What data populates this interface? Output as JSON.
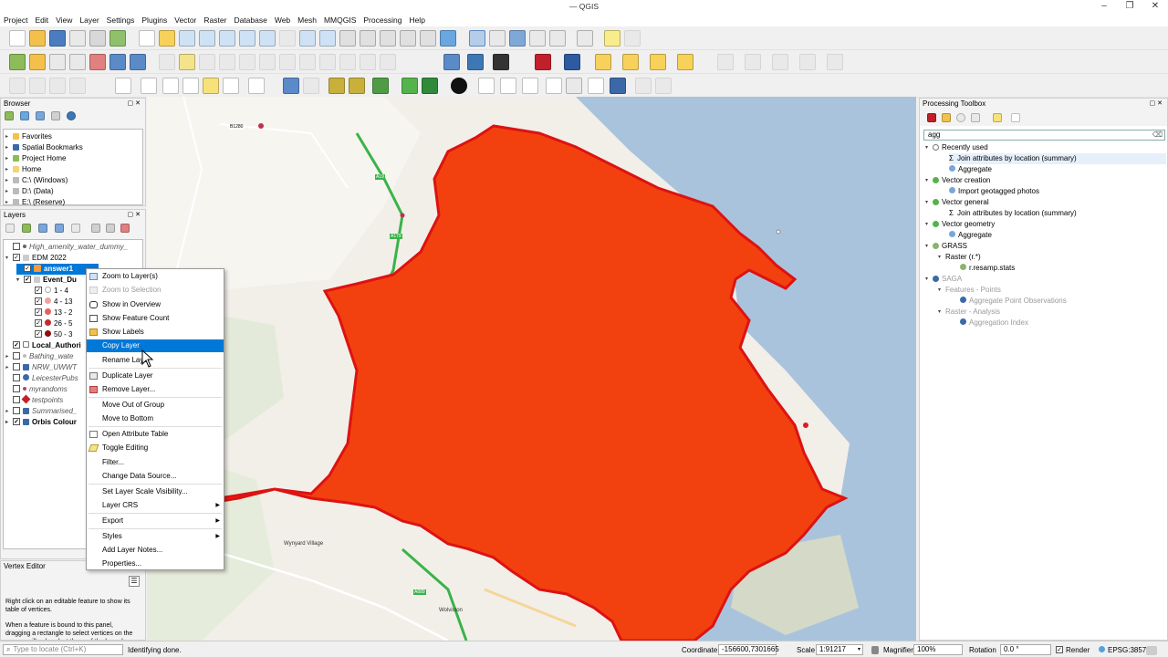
{
  "window": {
    "title": "QGIS",
    "partial_title": "—",
    "controls": [
      "–",
      "❐",
      "✕"
    ]
  },
  "menu": [
    "Project",
    "Edit",
    "View",
    "Layer",
    "Settings",
    "Plugins",
    "Vector",
    "Raster",
    "Database",
    "Web",
    "Mesh",
    "MMQGIS",
    "Processing",
    "Help"
  ],
  "browser": {
    "title": "Browser",
    "items": [
      "Favorites",
      "Spatial Bookmarks",
      "Project Home",
      "Home",
      "C:\\ (Windows)",
      "D:\\ (Data)",
      "E:\\ (Reserve)"
    ]
  },
  "layers": {
    "title": "Layers",
    "rows": [
      {
        "label": "High_amenity_water_dummy_",
        "italic": true,
        "checked": false
      },
      {
        "label": "EDM 2022",
        "italic": false,
        "checked": true
      },
      {
        "label": "answer1",
        "italic": false,
        "checked": true,
        "selected": true
      },
      {
        "label": "Event_Du",
        "italic": false,
        "checked": true,
        "bold": true
      },
      {
        "label": "1 - 4",
        "checked": true
      },
      {
        "label": "4 - 13",
        "checked": true
      },
      {
        "label": "13 - 2",
        "checked": true
      },
      {
        "label": "26 - 5",
        "checked": true
      },
      {
        "label": "50 - 3",
        "checked": true
      },
      {
        "label": "Local_Authori",
        "checked": true,
        "bold": true
      },
      {
        "label": "Bathing_wate",
        "checked": false,
        "italic": true
      },
      {
        "label": "NRW_UWWT",
        "checked": false,
        "italic": true
      },
      {
        "label": "LeicesterPubs",
        "checked": false,
        "italic": true
      },
      {
        "label": "myrandoms",
        "checked": false,
        "italic": true
      },
      {
        "label": "testpoints",
        "checked": false,
        "italic": true
      },
      {
        "label": "Summarised_",
        "checked": false,
        "italic": true
      },
      {
        "label": "Orbis Colour",
        "checked": true,
        "bold": true
      }
    ]
  },
  "vertex_editor": {
    "title": "Vertex Editor",
    "text1": "Right click on an editable feature to show its table of vertices.",
    "text2": "When a feature is bound to this panel, dragging a rectangle to select vertices on the canvas will only select those of the bound feature."
  },
  "context_menu": [
    {
      "label": "Zoom to Layer(s)",
      "enabled": true
    },
    {
      "label": "Zoom to Selection",
      "enabled": false
    },
    {
      "label": "Show in Overview",
      "enabled": true
    },
    {
      "label": "Show Feature Count",
      "enabled": true
    },
    {
      "label": "Show Labels",
      "enabled": true
    },
    {
      "label": "Copy Layer",
      "enabled": true,
      "highlighted": true
    },
    {
      "label": "Rename Layer",
      "enabled": true
    },
    {
      "label": "Duplicate Layer",
      "enabled": true
    },
    {
      "label": "Remove Layer...",
      "enabled": true
    },
    {
      "label": "Move Out of Group",
      "enabled": true
    },
    {
      "label": "Move to Bottom",
      "enabled": true
    },
    {
      "label": "Open Attribute Table",
      "enabled": true
    },
    {
      "label": "Toggle Editing",
      "enabled": true
    },
    {
      "label": "Filter...",
      "enabled": true
    },
    {
      "label": "Change Data Source...",
      "enabled": true
    },
    {
      "label": "Set Layer Scale Visibility...",
      "enabled": true
    },
    {
      "label": "Layer CRS",
      "enabled": true,
      "submenu": true
    },
    {
      "label": "Export",
      "enabled": true,
      "submenu": true
    },
    {
      "label": "Styles",
      "enabled": true,
      "submenu": true
    },
    {
      "label": "Add Layer Notes...",
      "enabled": true
    },
    {
      "label": "Properties...",
      "enabled": true
    }
  ],
  "map_labels": [
    "Wynyard Village",
    "Wolviston",
    "A689",
    "A19",
    "B1280",
    "A179"
  ],
  "processing": {
    "title": "Processing Toolbox",
    "search": "agg",
    "tree": [
      {
        "label": "Recently used",
        "level": 0
      },
      {
        "label": "Join attributes by location (summary)",
        "level": 1
      },
      {
        "label": "Aggregate",
        "level": 1
      },
      {
        "label": "Vector creation",
        "level": 0
      },
      {
        "label": "Import geotagged photos",
        "level": 1
      },
      {
        "label": "Vector general",
        "level": 0
      },
      {
        "label": "Join attributes by location (summary)",
        "level": 1
      },
      {
        "label": "Vector geometry",
        "level": 0
      },
      {
        "label": "Aggregate",
        "level": 1
      },
      {
        "label": "GRASS",
        "level": 0
      },
      {
        "label": "Raster (r.*)",
        "level": 1
      },
      {
        "label": "r.resamp.stats",
        "level": 2
      },
      {
        "label": "SAGA",
        "level": 0,
        "dim": true
      },
      {
        "label": "Features - Points",
        "level": 1,
        "dim": true
      },
      {
        "label": "Aggregate Point Observations",
        "level": 2,
        "dim": true
      },
      {
        "label": "Raster - Analysis",
        "level": 1,
        "dim": true
      },
      {
        "label": "Aggregation Index",
        "level": 2,
        "dim": true
      }
    ]
  },
  "status": {
    "locate_placeholder": "Type to locate (Ctrl+K)",
    "message": "Identifying done.",
    "coord_label": "Coordinate",
    "coord_value": "-156600,7301665",
    "scale_label": "Scale",
    "scale_value": "1:91217",
    "magnifier_label": "Magnifier",
    "magnifier_value": "100%",
    "rotation_label": "Rotation",
    "rotation_value": "0.0 °",
    "render_label": "Render",
    "crs": "EPSG:3857"
  },
  "colors": {
    "polygon_fill": "#f2410f",
    "polygon_stroke": "#dd1212",
    "sea": "#aac3dd",
    "selection": "#0078d7"
  }
}
